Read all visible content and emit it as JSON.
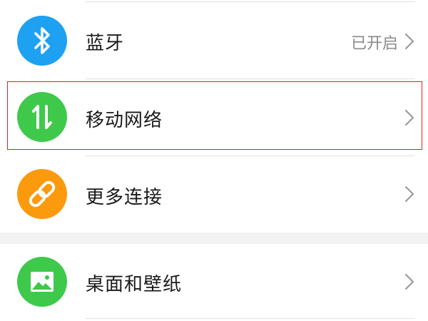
{
  "settings": {
    "items": [
      {
        "label": "蓝牙",
        "value": "已开启",
        "icon": "bluetooth-icon",
        "color": "#1ea1f1"
      },
      {
        "label": "移动网络",
        "value": "",
        "icon": "mobile-data-icon",
        "color": "#3ec94a"
      },
      {
        "label": "更多连接",
        "value": "",
        "icon": "link-icon",
        "color": "#fb9a0c"
      },
      {
        "label": "桌面和壁纸",
        "value": "",
        "icon": "image-icon",
        "color": "#3ec94a"
      }
    ]
  },
  "colors": {
    "highlight_border": "#e02020",
    "chevron": "#9a9a9a",
    "divider": "#e2e2e2"
  }
}
